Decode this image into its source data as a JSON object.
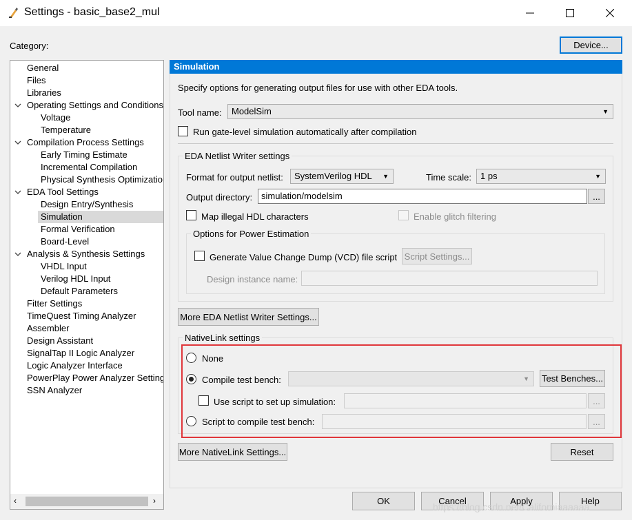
{
  "window": {
    "title": "Settings - basic_base2_mul"
  },
  "category_label": "Category:",
  "device_button": "Device...",
  "tree": [
    {
      "label": "General",
      "level": 0,
      "expand": ""
    },
    {
      "label": "Files",
      "level": 0,
      "expand": ""
    },
    {
      "label": "Libraries",
      "level": 0,
      "expand": ""
    },
    {
      "label": "Operating Settings and Conditions",
      "level": 0,
      "expand": "open"
    },
    {
      "label": "Voltage",
      "level": 1,
      "expand": ""
    },
    {
      "label": "Temperature",
      "level": 1,
      "expand": ""
    },
    {
      "label": "Compilation Process Settings",
      "level": 0,
      "expand": "open"
    },
    {
      "label": "Early Timing Estimate",
      "level": 1,
      "expand": ""
    },
    {
      "label": "Incremental Compilation",
      "level": 1,
      "expand": ""
    },
    {
      "label": "Physical Synthesis Optimization",
      "level": 1,
      "expand": ""
    },
    {
      "label": "EDA Tool Settings",
      "level": 0,
      "expand": "open"
    },
    {
      "label": "Design Entry/Synthesis",
      "level": 1,
      "expand": ""
    },
    {
      "label": "Simulation",
      "level": 1,
      "expand": "",
      "selected": true
    },
    {
      "label": "Formal Verification",
      "level": 1,
      "expand": ""
    },
    {
      "label": "Board-Level",
      "level": 1,
      "expand": ""
    },
    {
      "label": "Analysis & Synthesis Settings",
      "level": 0,
      "expand": "open"
    },
    {
      "label": "VHDL Input",
      "level": 1,
      "expand": ""
    },
    {
      "label": "Verilog HDL Input",
      "level": 1,
      "expand": ""
    },
    {
      "label": "Default Parameters",
      "level": 1,
      "expand": ""
    },
    {
      "label": "Fitter Settings",
      "level": 0,
      "expand": ""
    },
    {
      "label": "TimeQuest Timing Analyzer",
      "level": 0,
      "expand": ""
    },
    {
      "label": "Assembler",
      "level": 0,
      "expand": ""
    },
    {
      "label": "Design Assistant",
      "level": 0,
      "expand": ""
    },
    {
      "label": "SignalTap II Logic Analyzer",
      "level": 0,
      "expand": ""
    },
    {
      "label": "Logic Analyzer Interface",
      "level": 0,
      "expand": ""
    },
    {
      "label": "PowerPlay Power Analyzer Settings",
      "level": 0,
      "expand": ""
    },
    {
      "label": "SSN Analyzer",
      "level": 0,
      "expand": ""
    }
  ],
  "panel": {
    "heading": "Simulation",
    "description": "Specify options for generating output files for use with other EDA tools.",
    "tool_name_label": "Tool name:",
    "tool_name_value": "ModelSim",
    "run_gate_level": "Run gate-level simulation automatically after compilation",
    "eda_netlist": {
      "title": "EDA Netlist Writer settings",
      "format_label": "Format for output netlist:",
      "format_value": "SystemVerilog HDL",
      "time_scale_label": "Time scale:",
      "time_scale_value": "1 ps",
      "output_dir_label": "Output directory:",
      "output_dir_value": "simulation/modelsim",
      "browse": "...",
      "map_illegal": "Map illegal HDL characters",
      "enable_glitch": "Enable glitch filtering",
      "power": {
        "title": "Options for Power Estimation",
        "vcd_label": "Generate Value Change Dump (VCD) file script",
        "script_settings": "Script Settings...",
        "design_instance_label": "Design instance name:"
      }
    },
    "more_eda_button": "More EDA Netlist Writer Settings...",
    "nativelink": {
      "title": "NativeLink settings",
      "none": "None",
      "compile_tb": "Compile test bench:",
      "compile_tb_value": "",
      "test_benches": "Test Benches...",
      "use_script": "Use script to set up simulation:",
      "script_compile": "Script to compile test bench:",
      "browse": "..."
    },
    "more_nativelink_button": "More NativeLink Settings...",
    "reset_button": "Reset"
  },
  "footer": {
    "ok": "OK",
    "cancel": "Cancel",
    "apply": "Apply",
    "help": "Help"
  },
  "watermark": "https://blog.csdn.net/Californiaaaaaa"
}
